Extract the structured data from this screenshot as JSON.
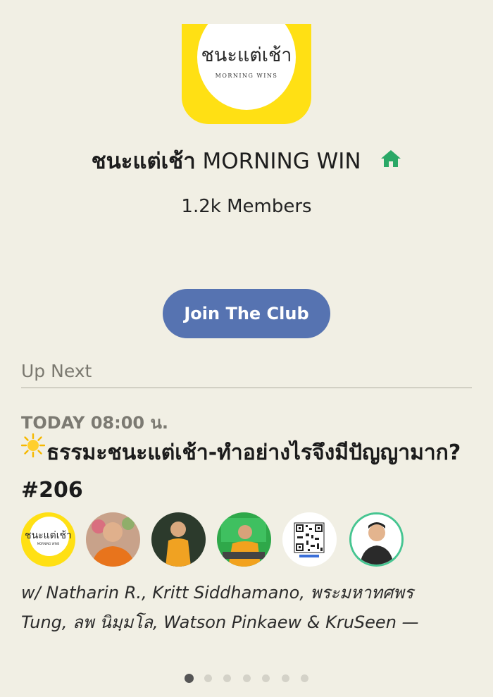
{
  "club": {
    "logo_text_thai": "ชนะแต่เช้า",
    "logo_text_en": "MORNING WINS",
    "title_thai": "ชนะแต่เช้า",
    "title_en": "MORNING WIN",
    "title_icon": "house-icon",
    "members": "1.2k Members",
    "join_label": "Join The Club"
  },
  "up_next": {
    "label": "Up Next",
    "event": {
      "time": "TODAY 08:00 น.",
      "title_icon": "sun-icon",
      "title": "ธรรมะชนะแต่เช้า-ทำอย่างไรจึงมีปัญญามาก? #206",
      "avatars": [
        {
          "name": "club-logo-avatar",
          "text_thai": "ชนะแต่เช้า",
          "text_en": "MORNING WINS"
        },
        {
          "name": "speaker-avatar-monk-1"
        },
        {
          "name": "speaker-avatar-monk-2"
        },
        {
          "name": "speaker-avatar-monk-3"
        },
        {
          "name": "qr-code-avatar"
        },
        {
          "name": "speaker-avatar-man"
        }
      ],
      "hosts_line1": "w/ Natharin R., Kritt Siddhamano, พระมหาทศพร",
      "hosts_line2": "Tung, ลพ นิมฺมโล, Watson Pinkaew & KruSeen —"
    }
  },
  "pagination": {
    "total_pages": 7,
    "current_page": 1
  },
  "colors": {
    "background": "#f1efe4",
    "accent_yellow": "#ffe014",
    "button_blue": "#5673b1",
    "house_green": "#2aa866"
  }
}
